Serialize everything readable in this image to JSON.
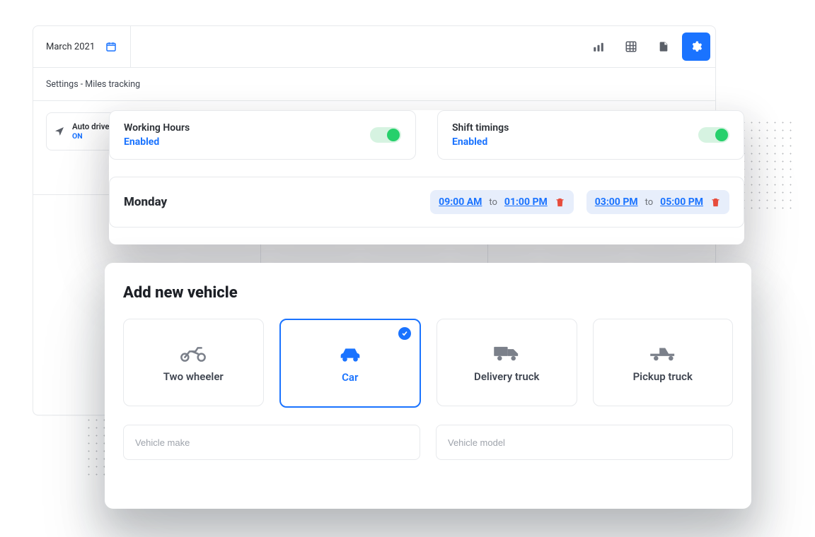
{
  "header": {
    "period_label": "March 2021",
    "icons": [
      "chart-icon",
      "grid-icon",
      "file-icon",
      "gear-icon"
    ],
    "active_icon": "gear-icon"
  },
  "subtitle": "Settings - Miles tracking",
  "auto_drive": {
    "label": "Auto drive",
    "status": "ON"
  },
  "settings_cards": {
    "working_hours": {
      "title": "Working Hours",
      "status": "Enabled",
      "toggle": true
    },
    "shift_timings": {
      "title": "Shift timings",
      "status": "Enabled",
      "toggle": true
    }
  },
  "day": {
    "name": "Monday",
    "slots": [
      {
        "from": "09:00 AM",
        "to_label": "to",
        "to": "01:00 PM"
      },
      {
        "from": "03:00 PM",
        "to_label": "to",
        "to": "05:00 PM"
      }
    ]
  },
  "vehicle": {
    "heading": "Add new vehicle",
    "options": [
      {
        "id": "two-wheeler",
        "label": "Two wheeler"
      },
      {
        "id": "car",
        "label": "Car",
        "selected": true
      },
      {
        "id": "delivery-truck",
        "label": "Delivery truck"
      },
      {
        "id": "pickup-truck",
        "label": "Pickup truck"
      }
    ],
    "fields": {
      "make_placeholder": "Vehicle make",
      "model_placeholder": "Vehicle model"
    }
  }
}
